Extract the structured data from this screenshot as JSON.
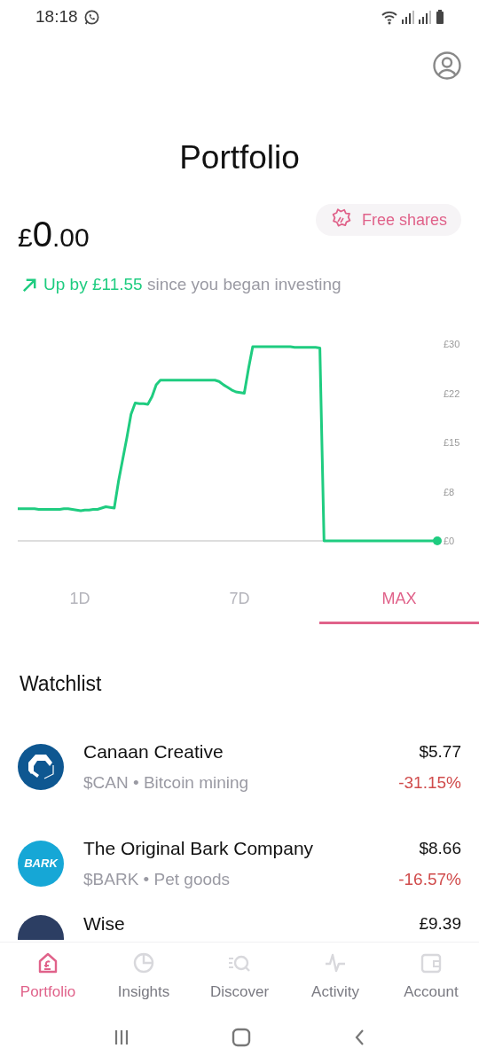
{
  "status_bar": {
    "time": "18:18"
  },
  "header": {
    "title": "Portfolio"
  },
  "balance": {
    "currency": "£",
    "whole": "0",
    "fraction": ".00"
  },
  "free_shares": {
    "label": "Free shares"
  },
  "performance": {
    "change": "Up by £11.55",
    "rest": "since you began investing"
  },
  "chart": {
    "chart_data": {
      "type": "line",
      "ylim": [
        0,
        30
      ],
      "yticks": [
        {
          "value": 0,
          "label": "£0"
        },
        {
          "value": 7.5,
          "label": "£8"
        },
        {
          "value": 15,
          "label": "£15"
        },
        {
          "value": 22.5,
          "label": "£22"
        },
        {
          "value": 30,
          "label": "£30"
        }
      ],
      "categories": [
        null,
        null,
        null,
        null,
        null,
        null,
        null,
        null,
        null,
        null,
        null,
        null,
        null,
        null,
        null,
        null,
        null,
        null,
        null,
        null,
        null,
        null,
        null,
        null,
        null,
        null,
        null,
        null,
        null,
        null,
        null,
        null,
        null,
        null,
        null,
        null,
        null,
        null,
        null,
        null,
        null,
        null,
        null,
        null,
        null,
        null,
        null,
        null,
        null,
        null,
        null,
        null,
        null,
        null,
        null,
        null,
        null,
        null,
        null,
        null,
        null,
        null,
        null,
        null,
        null,
        null,
        null,
        null,
        null,
        null,
        null,
        null,
        null,
        null,
        null,
        null,
        null,
        null,
        null,
        null,
        null,
        null,
        null,
        null,
        null,
        null,
        null,
        null,
        null,
        null,
        null,
        null,
        null,
        null,
        null,
        null,
        null,
        null,
        null,
        null,
        null
      ],
      "series": [
        {
          "color": "#1fcc80",
          "values": [
            4.9,
            4.9,
            4.9,
            4.9,
            4.9,
            4.8,
            4.8,
            4.8,
            4.8,
            4.8,
            4.8,
            4.9,
            4.9,
            4.8,
            4.7,
            4.6,
            4.7,
            4.7,
            4.8,
            4.8,
            5.0,
            5.2,
            5.1,
            5.0,
            9.0,
            12.4,
            15.7,
            19.3,
            21.0,
            20.9,
            20.9,
            20.8,
            22.0,
            23.8,
            24.5,
            24.5,
            24.5,
            24.5,
            24.5,
            24.5,
            24.5,
            24.5,
            24.5,
            24.5,
            24.5,
            24.5,
            24.5,
            24.5,
            24.3,
            23.8,
            23.4,
            23.0,
            22.7,
            22.6,
            22.5,
            26.3,
            29.6,
            29.6,
            29.6,
            29.6,
            29.6,
            29.6,
            29.6,
            29.6,
            29.6,
            29.6,
            29.5,
            29.5,
            29.5,
            29.5,
            29.5,
            29.5,
            29.4,
            0,
            0,
            0,
            0,
            0,
            0,
            0,
            0,
            0,
            0,
            0,
            0,
            0,
            0,
            0,
            0,
            0,
            0,
            0,
            0,
            0,
            0,
            0,
            0,
            0,
            0,
            0,
            0
          ]
        }
      ]
    }
  },
  "ranges": [
    {
      "label": "1D",
      "selected": false
    },
    {
      "label": "7D",
      "selected": false
    },
    {
      "label": "MAX",
      "selected": true
    }
  ],
  "watchlist": {
    "title": "Watchlist",
    "items": [
      {
        "name": "Canaan Creative",
        "info": "$CAN • Bitcoin mining",
        "price": "$5.77",
        "change": "-31.15%",
        "color": "#0e5791",
        "kind": "hexagon"
      },
      {
        "name": "The Original Bark Company",
        "info": "$BARK • Pet goods",
        "price": "$8.66",
        "change": "-16.57%",
        "color": "#16a7d6",
        "kind": "text",
        "logo_text": "BARK"
      },
      {
        "name": "Wise",
        "price": "£9.39",
        "color": "#2c3e63",
        "kind": "plain"
      }
    ]
  },
  "nav": [
    {
      "label": "Portfolio",
      "selected": true
    },
    {
      "label": "Insights",
      "selected": false
    },
    {
      "label": "Discover",
      "selected": false
    },
    {
      "label": "Activity",
      "selected": false
    },
    {
      "label": "Account",
      "selected": false
    }
  ]
}
